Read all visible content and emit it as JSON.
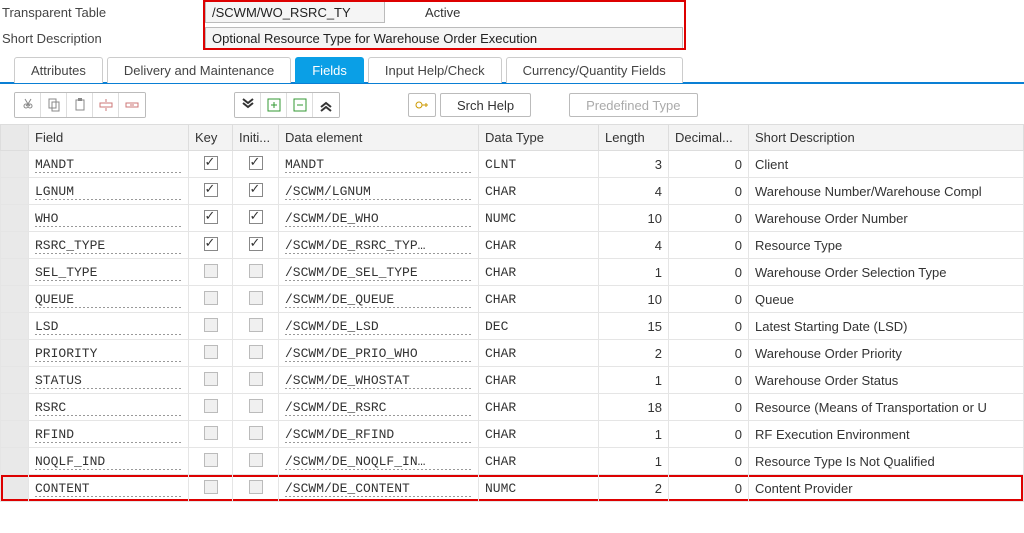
{
  "header": {
    "label_table": "Transparent Table",
    "table_name": "/SCWM/WO_RSRC_TY",
    "status": "Active",
    "label_desc": "Short Description",
    "short_desc": "Optional Resource Type for Warehouse Order Execution"
  },
  "tabs": [
    {
      "label": "Attributes",
      "active": false
    },
    {
      "label": "Delivery and Maintenance",
      "active": false
    },
    {
      "label": "Fields",
      "active": true
    },
    {
      "label": "Input Help/Check",
      "active": false
    },
    {
      "label": "Currency/Quantity Fields",
      "active": false
    }
  ],
  "toolbar": {
    "srch_help": "Srch Help",
    "predefined_type": "Predefined Type"
  },
  "columns": {
    "field": "Field",
    "key": "Key",
    "init": "Initi...",
    "data_element": "Data element",
    "data_type": "Data Type",
    "length": "Length",
    "decimal": "Decimal...",
    "short_desc": "Short Description"
  },
  "rows": [
    {
      "field": "MANDT",
      "key": true,
      "init": true,
      "de": "MANDT",
      "dtype": "CLNT",
      "len": "3",
      "dec": "0",
      "desc": "Client",
      "hl": false
    },
    {
      "field": "LGNUM",
      "key": true,
      "init": true,
      "de": "/SCWM/LGNUM",
      "dtype": "CHAR",
      "len": "4",
      "dec": "0",
      "desc": "Warehouse Number/Warehouse Compl",
      "hl": false
    },
    {
      "field": "WHO",
      "key": true,
      "init": true,
      "de": "/SCWM/DE_WHO",
      "dtype": "NUMC",
      "len": "10",
      "dec": "0",
      "desc": "Warehouse Order Number",
      "hl": false
    },
    {
      "field": "RSRC_TYPE",
      "key": true,
      "init": true,
      "de": "/SCWM/DE_RSRC_TYP…",
      "dtype": "CHAR",
      "len": "4",
      "dec": "0",
      "desc": "Resource Type",
      "hl": false
    },
    {
      "field": "SEL_TYPE",
      "key": false,
      "init": false,
      "de": "/SCWM/DE_SEL_TYPE",
      "dtype": "CHAR",
      "len": "1",
      "dec": "0",
      "desc": "Warehouse Order Selection Type",
      "hl": false
    },
    {
      "field": "QUEUE",
      "key": false,
      "init": false,
      "de": "/SCWM/DE_QUEUE",
      "dtype": "CHAR",
      "len": "10",
      "dec": "0",
      "desc": "Queue",
      "hl": false
    },
    {
      "field": "LSD",
      "key": false,
      "init": false,
      "de": "/SCWM/DE_LSD",
      "dtype": "DEC",
      "len": "15",
      "dec": "0",
      "desc": "Latest Starting Date (LSD)",
      "hl": false
    },
    {
      "field": "PRIORITY",
      "key": false,
      "init": false,
      "de": "/SCWM/DE_PRIO_WHO",
      "dtype": "CHAR",
      "len": "2",
      "dec": "0",
      "desc": "Warehouse Order Priority",
      "hl": false
    },
    {
      "field": "STATUS",
      "key": false,
      "init": false,
      "de": "/SCWM/DE_WHOSTAT",
      "dtype": "CHAR",
      "len": "1",
      "dec": "0",
      "desc": "Warehouse Order Status",
      "hl": false
    },
    {
      "field": "RSRC",
      "key": false,
      "init": false,
      "de": "/SCWM/DE_RSRC",
      "dtype": "CHAR",
      "len": "18",
      "dec": "0",
      "desc": "Resource (Means of Transportation or U",
      "hl": false
    },
    {
      "field": "RFIND",
      "key": false,
      "init": false,
      "de": "/SCWM/DE_RFIND",
      "dtype": "CHAR",
      "len": "1",
      "dec": "0",
      "desc": "RF Execution Environment",
      "hl": false
    },
    {
      "field": "NOQLF_IND",
      "key": false,
      "init": false,
      "de": "/SCWM/DE_NOQLF_IN…",
      "dtype": "CHAR",
      "len": "1",
      "dec": "0",
      "desc": "Resource Type Is Not Qualified",
      "hl": false
    },
    {
      "field": "CONTENT",
      "key": false,
      "init": false,
      "de": "/SCWM/DE_CONTENT",
      "dtype": "NUMC",
      "len": "2",
      "dec": "0",
      "desc": "Content Provider",
      "hl": true
    }
  ]
}
